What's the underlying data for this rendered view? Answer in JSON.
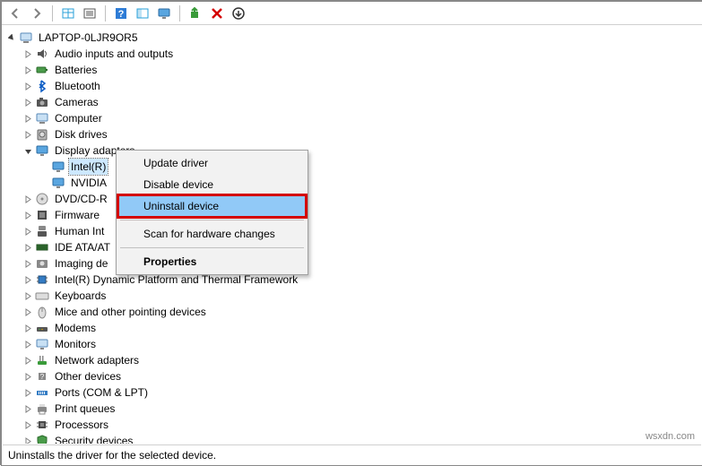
{
  "toolbar": {
    "back": "Back",
    "forward": "Forward",
    "show_hidden": "Show hidden",
    "properties": "Properties",
    "help": "Help",
    "details": "Details",
    "monitor": "Monitor",
    "update": "Update",
    "remove": "Remove",
    "scan": "Scan"
  },
  "tree": {
    "root": "LAPTOP-0LJR9OR5",
    "categories": [
      {
        "label": "Audio inputs and outputs",
        "icon": "speaker",
        "expanded": false
      },
      {
        "label": "Batteries",
        "icon": "battery",
        "expanded": false
      },
      {
        "label": "Bluetooth",
        "icon": "bluetooth",
        "expanded": false
      },
      {
        "label": "Cameras",
        "icon": "camera",
        "expanded": false
      },
      {
        "label": "Computer",
        "icon": "computer",
        "expanded": false
      },
      {
        "label": "Disk drives",
        "icon": "disk",
        "expanded": false
      },
      {
        "label": "Display adapters",
        "icon": "display",
        "expanded": true,
        "children": [
          {
            "label": "Intel(R)",
            "selected": true
          },
          {
            "label": "NVIDIA"
          }
        ]
      },
      {
        "label": "DVD/CD-R",
        "icon": "dvd",
        "expanded": false,
        "clipped": true
      },
      {
        "label": "Firmware",
        "icon": "firmware",
        "expanded": false,
        "clipped": true
      },
      {
        "label": "Human Int",
        "icon": "hid",
        "expanded": false,
        "clipped": true
      },
      {
        "label": "IDE ATA/AT",
        "icon": "ide",
        "expanded": false,
        "clipped": true
      },
      {
        "label": "Imaging de",
        "icon": "imaging",
        "expanded": false,
        "clipped": true
      },
      {
        "label": "Intel(R) Dynamic Platform and Thermal Framework",
        "icon": "chip",
        "expanded": false
      },
      {
        "label": "Keyboards",
        "icon": "keyboard",
        "expanded": false
      },
      {
        "label": "Mice and other pointing devices",
        "icon": "mouse",
        "expanded": false
      },
      {
        "label": "Modems",
        "icon": "modem",
        "expanded": false
      },
      {
        "label": "Monitors",
        "icon": "monitor",
        "expanded": false
      },
      {
        "label": "Network adapters",
        "icon": "network",
        "expanded": false
      },
      {
        "label": "Other devices",
        "icon": "other",
        "expanded": false
      },
      {
        "label": "Ports (COM & LPT)",
        "icon": "port",
        "expanded": false
      },
      {
        "label": "Print queues",
        "icon": "printer",
        "expanded": false
      },
      {
        "label": "Processors",
        "icon": "cpu",
        "expanded": false
      },
      {
        "label": "Security devices",
        "icon": "security",
        "expanded": false
      }
    ]
  },
  "context_menu": {
    "update": "Update driver",
    "disable": "Disable device",
    "uninstall": "Uninstall device",
    "scan": "Scan for hardware changes",
    "properties": "Properties"
  },
  "statusbar": {
    "text": "Uninstalls the driver for the selected device."
  },
  "watermark": "wsxdn.com"
}
